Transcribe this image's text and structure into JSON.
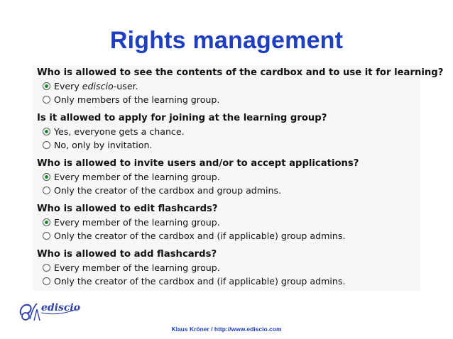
{
  "title": "Rights management",
  "sections": [
    {
      "question": "Who is allowed to see the contents of the cardbox and to use it for learning?",
      "options": [
        {
          "label_prefix": "Every ",
          "label_brand": "ediscio",
          "label_suffix": "-user.",
          "selected": true
        },
        {
          "label": "Only members of the learning group.",
          "selected": false
        }
      ]
    },
    {
      "question": "Is it allowed to apply for joining at the learning group?",
      "options": [
        {
          "label": "Yes, everyone gets a chance.",
          "selected": true
        },
        {
          "label": "No, only by invitation.",
          "selected": false
        }
      ]
    },
    {
      "question": "Who is allowed to invite users and/or to accept applications?",
      "options": [
        {
          "label": "Every member of the learning group.",
          "selected": true
        },
        {
          "label": "Only the creator of the cardbox and group admins.",
          "selected": false
        }
      ]
    },
    {
      "question": "Who is allowed to edit flashcards?",
      "options": [
        {
          "label": "Every member of the learning group.",
          "selected": true
        },
        {
          "label": "Only the creator of the cardbox and (if applicable) group admins.",
          "selected": false
        }
      ]
    },
    {
      "question": "Who is allowed to add flashcards?",
      "options": [
        {
          "label": "Every member of the learning group.",
          "selected": false
        },
        {
          "label": "Only the creator of the cardbox and (if applicable) group admins.",
          "selected": false
        }
      ]
    }
  ],
  "logo_text": "ediscio",
  "footer": "Klaus Kröner / http://www.ediscio.com",
  "colors": {
    "title": "#1f3fc2",
    "radio_selected": "#1b8a2e",
    "panel_bg": "#f7f7f7"
  }
}
